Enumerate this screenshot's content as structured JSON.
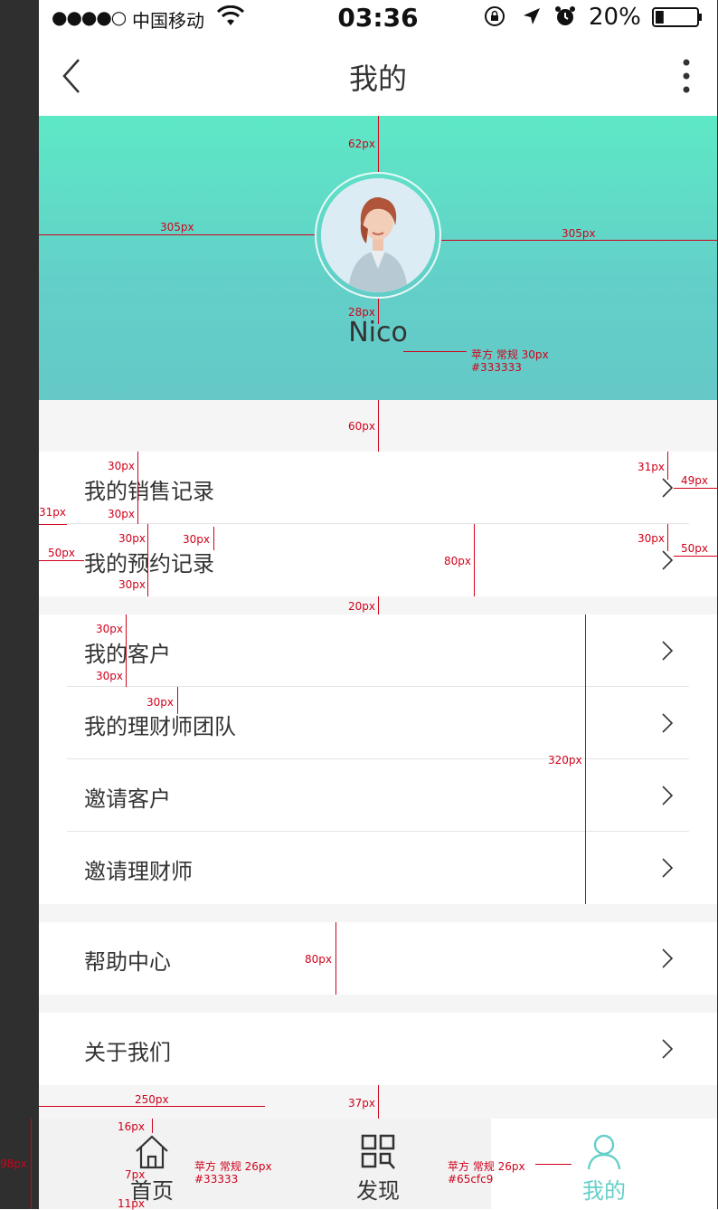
{
  "status_bar": {
    "signal": "●●●●○",
    "carrier": "中国移动",
    "time": "03:36",
    "battery_pct": "20%",
    "battery_level": 0.2
  },
  "navbar": {
    "title": "我的"
  },
  "profile": {
    "name": "Nico"
  },
  "groups": [
    {
      "items": [
        "我的销售记录",
        "我的预约记录"
      ]
    },
    {
      "items": [
        "我的客户",
        "我的理财师团队",
        "邀请客户",
        "邀请理财师"
      ]
    },
    {
      "items": [
        "帮助中心"
      ]
    },
    {
      "items": [
        "关于我们"
      ]
    }
  ],
  "tabbar": {
    "tabs": [
      {
        "label": "首页",
        "icon": "home-icon",
        "active": false
      },
      {
        "label": "发现",
        "icon": "scan-icon",
        "active": false
      },
      {
        "label": "我的",
        "icon": "user-icon",
        "active": true
      }
    ]
  },
  "colors": {
    "text": "#333333",
    "accent": "#65cfc9",
    "annotation": "#d0021b"
  },
  "annotations": {
    "m62": "62px",
    "m305a": "305px",
    "m305b": "305px",
    "m28": "28px",
    "font_note1": "苹方 常规 30px",
    "font_color1": "#333333",
    "m60": "60px",
    "m30a": "30px",
    "m31a": "31px",
    "m49": "49px",
    "m30b": "30px",
    "m31b": "31px",
    "m30c": "30px",
    "m30d": "30px",
    "m50a": "50px",
    "m80a": "80px",
    "m30e": "30px",
    "m50b": "50px",
    "m30f": "30px",
    "m20": "20px",
    "m30g": "30px",
    "m30h": "30px",
    "m30i": "30px",
    "m320": "320px",
    "m80b": "80px",
    "m250": "250px",
    "m37": "37px",
    "m16": "16px",
    "m98": "98px",
    "m7": "7px",
    "m11": "11px",
    "font_note2": "苹方 常规 26px",
    "font_color2": "#33333",
    "font_note3": "苹方 常规 26px",
    "font_color3": "#65cfc9"
  }
}
